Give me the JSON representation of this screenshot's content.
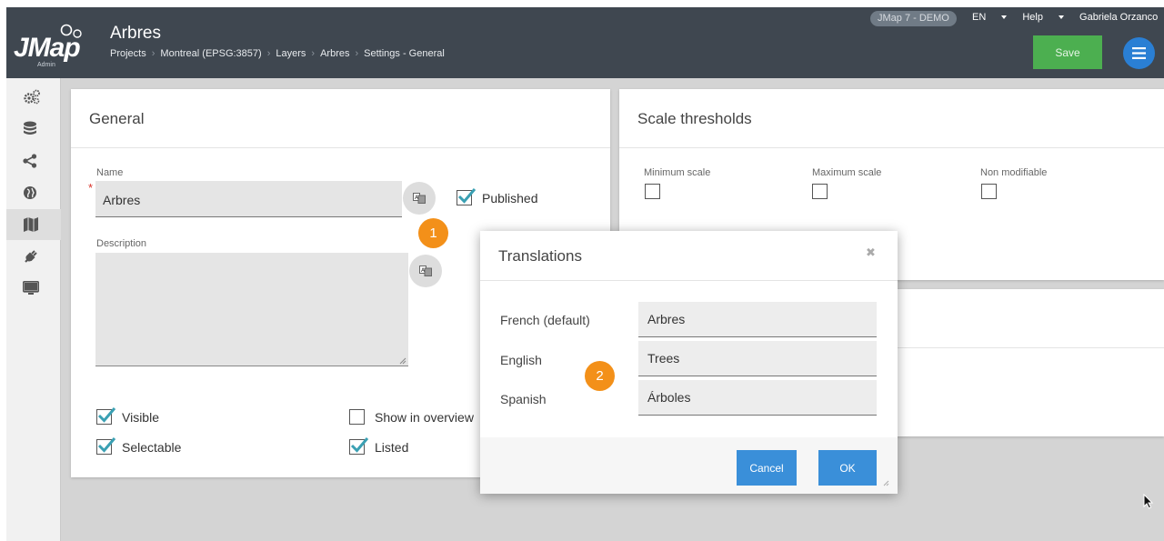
{
  "header": {
    "logo_text": "JMap",
    "logo_sub": "Admin",
    "page_title": "Arbres",
    "breadcrumb": [
      "Projects",
      "Montreal (EPSG:3857)",
      "Layers",
      "Arbres",
      "Settings - General"
    ],
    "environment_badge": "JMap 7 - DEMO",
    "language": "EN",
    "help": "Help",
    "user": "Gabriela Orzanco",
    "save_label": "Save"
  },
  "sidebar": {
    "items": [
      {
        "icon": "gears-icon",
        "active": false
      },
      {
        "icon": "database-icon",
        "active": false
      },
      {
        "icon": "share-icon",
        "active": false
      },
      {
        "icon": "globe-icon",
        "active": false
      },
      {
        "icon": "map-icon",
        "active": true
      },
      {
        "icon": "plug-icon",
        "active": false
      },
      {
        "icon": "monitor-icon",
        "active": false
      }
    ]
  },
  "general": {
    "title": "General",
    "name_label": "Name",
    "name_value": "Arbres",
    "published_label": "Published",
    "published": true,
    "description_label": "Description",
    "description_value": "",
    "checkboxes": {
      "visible": {
        "label": "Visible",
        "checked": true
      },
      "selectable": {
        "label": "Selectable",
        "checked": true
      },
      "show_in_overview": {
        "label": "Show in overview",
        "checked": false
      },
      "listed": {
        "label": "Listed",
        "checked": true
      }
    }
  },
  "scale": {
    "title": "Scale thresholds",
    "min_label": "Minimum scale",
    "max_label": "Maximum scale",
    "non_modifiable_label": "Non modifiable"
  },
  "steps": {
    "one": "1",
    "two": "2"
  },
  "translations": {
    "title": "Translations",
    "rows": [
      {
        "language": "French (default)",
        "value": "Arbres"
      },
      {
        "language": "English",
        "value": "Trees"
      },
      {
        "language": "Spanish",
        "value": "Árboles"
      }
    ],
    "cancel_label": "Cancel",
    "ok_label": "OK"
  },
  "colors": {
    "topbar": "#3f4750",
    "save_green": "#4caf50",
    "accent_blue": "#3a8fd9",
    "step_orange": "#f39019",
    "check_teal": "#3aa0b3"
  }
}
